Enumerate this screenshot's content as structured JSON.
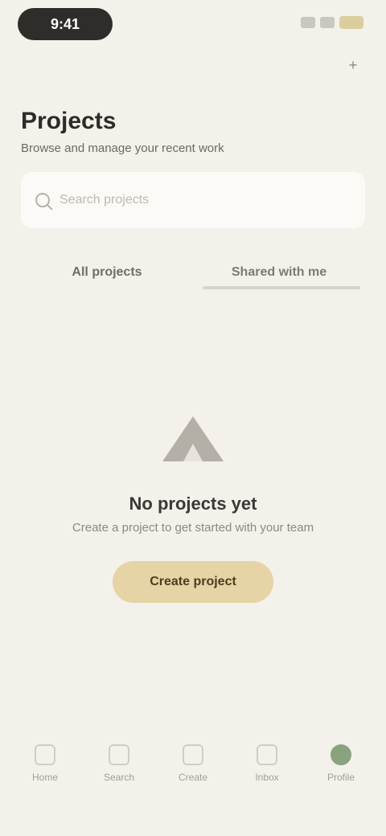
{
  "status_bar": {
    "time": "9:41",
    "icons": [
      "signal-icon",
      "wifi-icon",
      "battery-icon"
    ]
  },
  "header": {
    "action_icon": "plus-icon",
    "title": "Projects",
    "subtitle": "Browse and manage your recent work"
  },
  "search": {
    "placeholder": "Search projects",
    "value": ""
  },
  "tabs": [
    {
      "label": "All projects"
    },
    {
      "label": "Shared with me"
    }
  ],
  "empty_state": {
    "title": "No projects yet",
    "subtitle": "Create a project to get started with your team",
    "cta_label": "Create project"
  },
  "bottom_nav": [
    {
      "label": "Home",
      "icon": "home-icon"
    },
    {
      "label": "Search",
      "icon": "search-icon"
    },
    {
      "label": "Create",
      "icon": "plus-icon"
    },
    {
      "label": "Inbox",
      "icon": "inbox-icon"
    },
    {
      "label": "Profile",
      "icon": "profile-icon"
    }
  ],
  "colors": {
    "background": "#f3f1ea",
    "accent": "#e6d3a6",
    "active_nav": "#8aa37f"
  }
}
